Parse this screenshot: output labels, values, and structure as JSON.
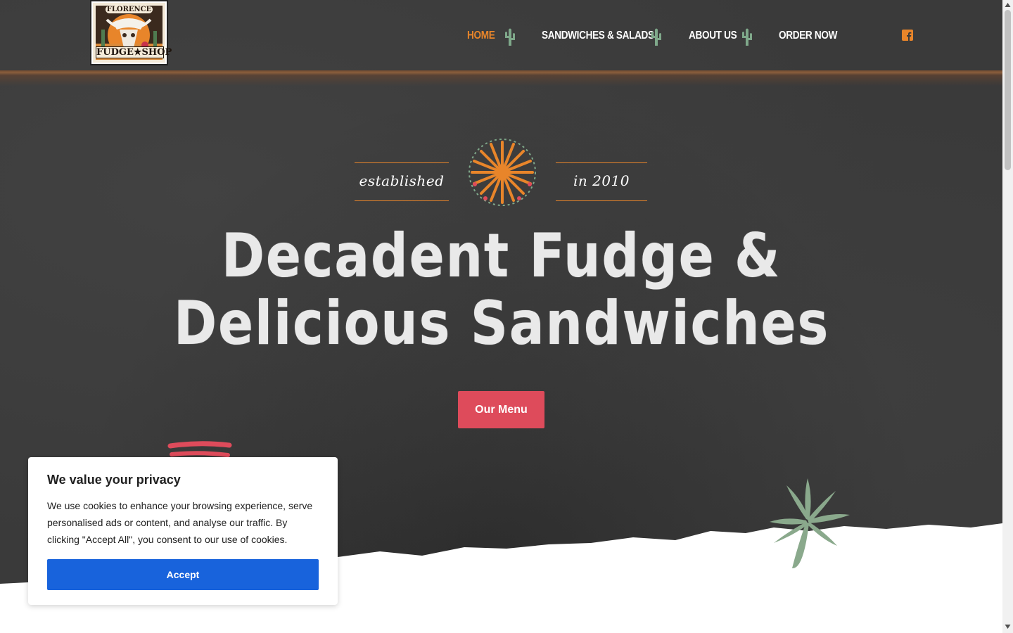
{
  "header": {
    "logo": {
      "alt": "Florence Fudge Shop",
      "top_text": "FLORENCE",
      "bottom_text": "FUDGE★SHOP"
    },
    "nav": [
      {
        "label": "HOME",
        "active": true
      },
      {
        "label": "SANDWICHES & SALADS",
        "active": false
      },
      {
        "label": "ABOUT US",
        "active": false
      },
      {
        "label": "ORDER NOW",
        "active": false
      }
    ],
    "social_icon": "facebook-icon"
  },
  "hero": {
    "established_left": "established",
    "established_right": "in 2010",
    "headline_line1": "Decadent Fudge &",
    "headline_line2": "Delicious Sandwiches",
    "cta_label": "Our Menu"
  },
  "cookie_banner": {
    "title": "We value your privacy",
    "text": "We use cookies to enhance your browsing experience, serve personalised ads or content, and analyse our traffic. By clicking \"Accept All\", you consent to our use of cookies.",
    "accept_label": "Accept"
  },
  "colors": {
    "accent_orange": "#e8852a",
    "cta_red": "#de4b5b",
    "cactus_green": "#7fa88a",
    "cookie_blue": "#1863dc",
    "background_dark": "#3a3a3a"
  }
}
